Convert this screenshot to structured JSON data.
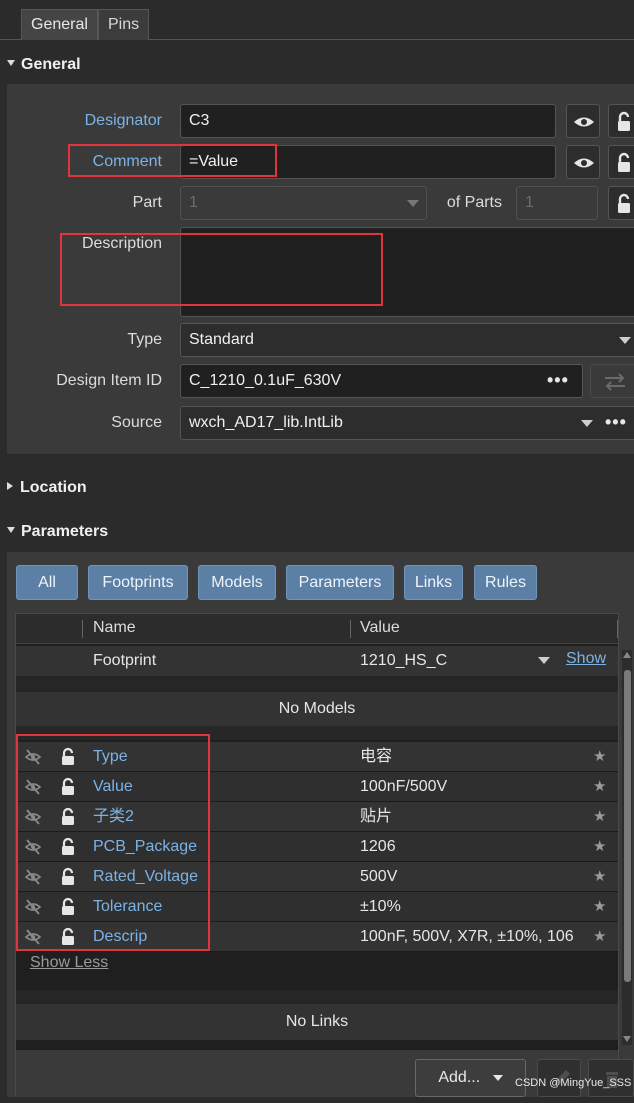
{
  "tabs": [
    {
      "label": "General",
      "active": true
    },
    {
      "label": "Pins",
      "active": false
    }
  ],
  "sections": {
    "general": "General",
    "location": "Location",
    "parameters": "Parameters"
  },
  "general": {
    "designator_label": "Designator",
    "designator_value": "C3",
    "comment_label": "Comment",
    "comment_value": "=Value",
    "part_label": "Part",
    "part_value": "1",
    "of_parts_label": "of Parts",
    "of_parts_value": "1",
    "description_label": "Description",
    "description_value": "",
    "type_label": "Type",
    "type_value": "Standard",
    "design_item_id_label": "Design Item ID",
    "design_item_id_value": "C_1210_0.1uF_630V",
    "source_label": "Source",
    "source_value": "wxch_AD17_lib.IntLib",
    "dots": "•••"
  },
  "filters": [
    "All",
    "Footprints",
    "Models",
    "Parameters",
    "Links",
    "Rules"
  ],
  "table": {
    "col_name": "Name",
    "col_value": "Value",
    "footprint": {
      "name": "Footprint",
      "value": "1210_HS_C",
      "link": "Show"
    },
    "no_models": "No Models",
    "parameters": [
      {
        "name": "Type",
        "value": "电容"
      },
      {
        "name": "Value",
        "value": "100nF/500V"
      },
      {
        "name": "子类2",
        "value": "贴片"
      },
      {
        "name": "PCB_Package",
        "value": "1206"
      },
      {
        "name": "Rated_Voltage",
        "value": "500V"
      },
      {
        "name": "Tolerance",
        "value": "±10%"
      },
      {
        "name": "Descrip",
        "value": "100nF, 500V, X7R, ±10%, 106"
      }
    ],
    "show_less": "Show Less",
    "no_links": "No Links"
  },
  "actions": {
    "add": "Add..."
  },
  "watermark": "CSDN @MingYue_SSS",
  "colors": {
    "accent": "#5b7fa5",
    "link_text": "#7cb3e6",
    "highlight": "#e0353d",
    "background": "#2b2b2b"
  }
}
